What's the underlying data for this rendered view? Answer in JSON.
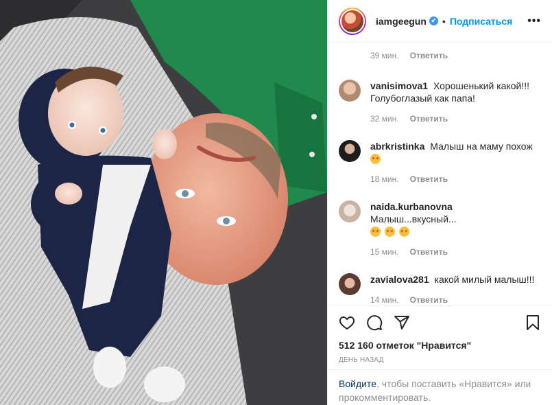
{
  "post": {
    "username": "iamgeegun",
    "verified_mark": "✔",
    "separator": "•",
    "follow_label": "Подписаться",
    "more_label": "•••"
  },
  "first_comment_meta": {
    "time": "39 мин.",
    "reply": "Ответить"
  },
  "comments": [
    {
      "user": "vanisimova1",
      "text": "Хорошенький какой!!! Голубоглазый как папа!",
      "time": "32 мин.",
      "reply": "Ответить",
      "avatar_color": "#c9a98f"
    },
    {
      "user": "abrkristinka",
      "text": "Малыш на маму похож",
      "emoji_count": 1,
      "time": "18 мин.",
      "reply": "Ответить",
      "avatar_color": "#2b2b2b"
    },
    {
      "user": "naida.kurbanovna",
      "text": "Малыш...вкусный...",
      "emoji_count": 3,
      "time": "15 мин.",
      "reply": "Ответить",
      "avatar_color": "#d8c6b8"
    },
    {
      "user": "zavialova281",
      "text": "какой милый малыш!!!",
      "time": "14 мин.",
      "reply": "Ответить",
      "avatar_color": "#7a5a4e"
    }
  ],
  "actions": {
    "like_icon": "heart-icon",
    "comment_icon": "comment-icon",
    "share_icon": "share-icon",
    "save_icon": "bookmark-icon"
  },
  "likes_text": "512 160 отметок \"Нравится\"",
  "posted_ago": "День назад",
  "login": {
    "link": "Войдите",
    "rest": ", чтобы поставить «Нравится» или прокомментировать."
  },
  "colors": {
    "link_blue": "#0095f6",
    "muted": "#8e8e8e",
    "shirt_green": "#1f8a4c",
    "baby_suit_navy": "#1c2545"
  }
}
